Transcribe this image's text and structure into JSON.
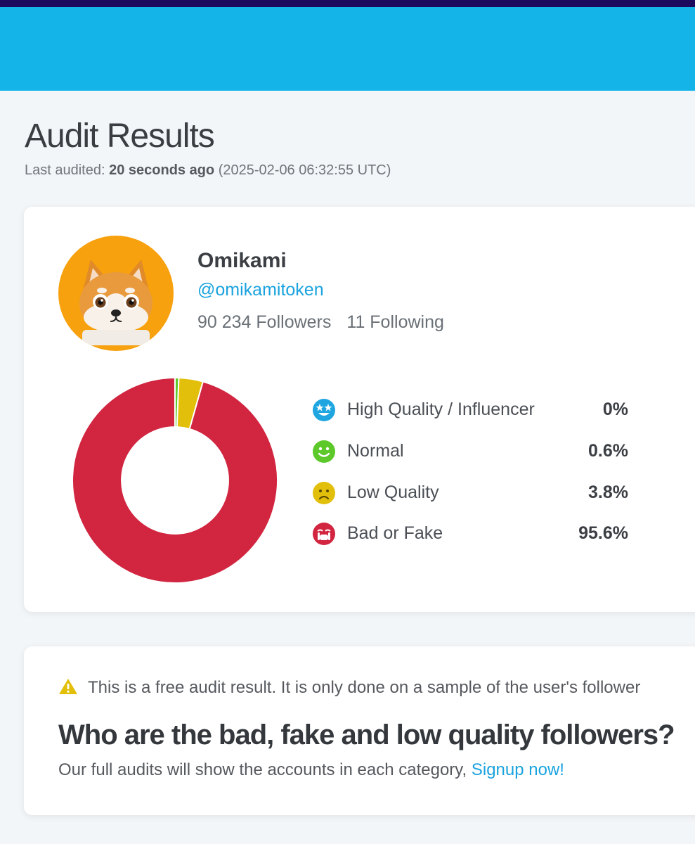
{
  "header": {
    "colors": {
      "top_strip": "#1d0a5c",
      "banner": "#14b3e8"
    }
  },
  "page": {
    "title": "Audit Results",
    "last_audited_label": "Last audited:",
    "last_audited_relative": "20 seconds ago",
    "last_audited_timestamp": "(2025-02-06 06:32:55 UTC)"
  },
  "profile": {
    "name": "Omikami",
    "handle": "@omikamitoken",
    "followers": "90 234 Followers",
    "following": "11 Following",
    "avatar_icon": "shiba-dog-avatar"
  },
  "chart_data": {
    "type": "pie",
    "categories": [
      "High Quality / Influencer",
      "Normal",
      "Low Quality",
      "Bad or Fake"
    ],
    "values": [
      0,
      0.6,
      3.8,
      95.6
    ],
    "labels": [
      "0%",
      "0.6%",
      "3.8%",
      "95.6%"
    ],
    "colors": [
      "#1fa6e0",
      "#5cc82a",
      "#e2bf0a",
      "#d12540"
    ],
    "icons": [
      "star-eyes-face-icon",
      "smile-face-icon",
      "sad-face-icon",
      "crying-face-icon"
    ],
    "hole": 0.52,
    "legend_position": "right"
  },
  "notice": {
    "warning_icon": "warning-triangle-icon",
    "warning_text": "This is a free audit result. It is only done on a sample of the user's follower",
    "title": "Who are the bad, fake and low quality followers?",
    "text": "Our full audits will show the accounts in each category,",
    "link_text": "Signup now!"
  }
}
